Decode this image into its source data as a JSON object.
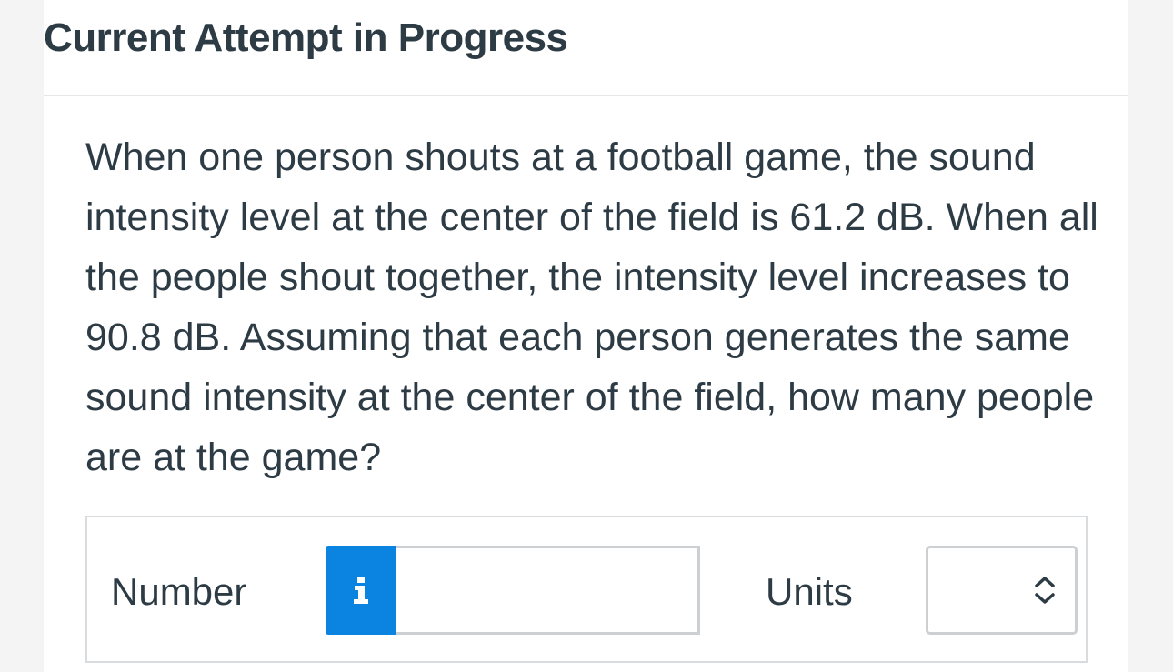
{
  "header": {
    "title": "Current Attempt in Progress"
  },
  "question": {
    "text": "When one person shouts at a football game, the sound intensity level at the center of the field is 61.2 dB. When all the people shout together, the intensity level increases to 90.8 dB. Assuming that each person generates the same sound intensity at the center of the field, how many people are at the game?"
  },
  "answer": {
    "number_label": "Number",
    "number_value": "",
    "number_placeholder": "",
    "info_icon": "info-icon",
    "units_label": "Units",
    "units_selected": "",
    "units_icon": "up-down-chevron-icon"
  },
  "colors": {
    "info_button": "#0a84e0",
    "text": "#2d3b45",
    "border": "#cdd0d2"
  }
}
